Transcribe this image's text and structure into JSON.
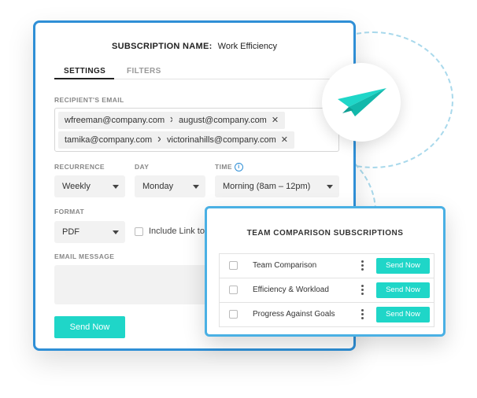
{
  "subscription": {
    "name_label": "SUBSCRIPTION NAME:",
    "name_value": "Work Efficiency"
  },
  "tabs": [
    {
      "label": "SETTINGS",
      "active": true
    },
    {
      "label": "FILTERS",
      "active": false
    }
  ],
  "recipients": {
    "label": "RECIPIENT'S EMAIL",
    "emails": [
      "wfreeman@company.com",
      "august@company.com",
      "tamika@company.com",
      "victorinahills@company.com"
    ],
    "remove_glyph": "✕"
  },
  "recurrence": {
    "label": "RECURRENCE",
    "value": "Weekly"
  },
  "day": {
    "label": "DAY",
    "value": "Monday"
  },
  "time": {
    "label": "TIME",
    "value": "Morning (8am – 12pm)",
    "info_glyph": "i"
  },
  "format": {
    "label": "FORMAT",
    "value": "PDF",
    "include_link_label": "Include Link to D"
  },
  "message": {
    "label": "EMAIL MESSAGE"
  },
  "send_now_label": "Send Now",
  "popup": {
    "title": "TEAM COMPARISON SUBSCRIPTIONS",
    "rows": [
      {
        "label": "Team Comparison",
        "button": "Send Now"
      },
      {
        "label": "Efficiency & Workload",
        "button": "Send Now"
      },
      {
        "label": "Progress Against Goals",
        "button": "Send Now"
      }
    ]
  },
  "colors": {
    "accent": "#1fd6c8",
    "frame": "#2f8fd6",
    "popup_frame": "#4ab0e4"
  },
  "icons": {
    "hero": "paper-plane-icon"
  }
}
